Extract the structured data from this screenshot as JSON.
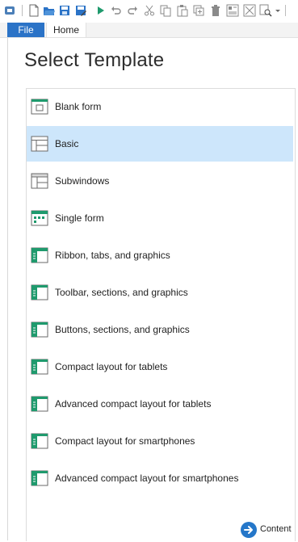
{
  "toolbar": {
    "icons": [
      "app-icon",
      "new-icon",
      "open-icon",
      "save-icon",
      "save-as-icon",
      "run-icon",
      "undo-icon",
      "redo-icon",
      "cut-icon",
      "copy-icon",
      "paste-icon",
      "duplicate-icon",
      "delete-icon",
      "form-icon",
      "settings-icon",
      "search-icon",
      "dropdown-icon"
    ]
  },
  "menubar": {
    "file_label": "File",
    "home_label": "Home"
  },
  "panel": {
    "title": "Select Template"
  },
  "templates": [
    {
      "label": "Blank form",
      "icon": "blank-form-icon",
      "selected": false
    },
    {
      "label": "Basic",
      "icon": "basic-template-icon",
      "selected": true
    },
    {
      "label": "Subwindows",
      "icon": "subwindows-template-icon",
      "selected": false
    },
    {
      "label": "Single form",
      "icon": "single-form-icon",
      "selected": false
    },
    {
      "label": "Ribbon, tabs, and graphics",
      "icon": "ribbon-template-icon",
      "selected": false
    },
    {
      "label": "Toolbar, sections, and graphics",
      "icon": "toolbar-template-icon",
      "selected": false
    },
    {
      "label": "Buttons, sections, and graphics",
      "icon": "buttons-template-icon",
      "selected": false
    },
    {
      "label": "Compact layout for tablets",
      "icon": "tablet-template-icon",
      "selected": false
    },
    {
      "label": "Advanced compact layout for tablets",
      "icon": "tablet-advanced-template-icon",
      "selected": false
    },
    {
      "label": "Compact layout for smartphones",
      "icon": "smartphone-template-icon",
      "selected": false
    },
    {
      "label": "Advanced compact layout for smartphones",
      "icon": "smartphone-advanced-template-icon",
      "selected": false
    }
  ],
  "footer": {
    "content_label": "Content"
  },
  "colors": {
    "accent": "#2b73c7",
    "selection": "#cde6fb",
    "icon_green": "#1f9a6d"
  }
}
